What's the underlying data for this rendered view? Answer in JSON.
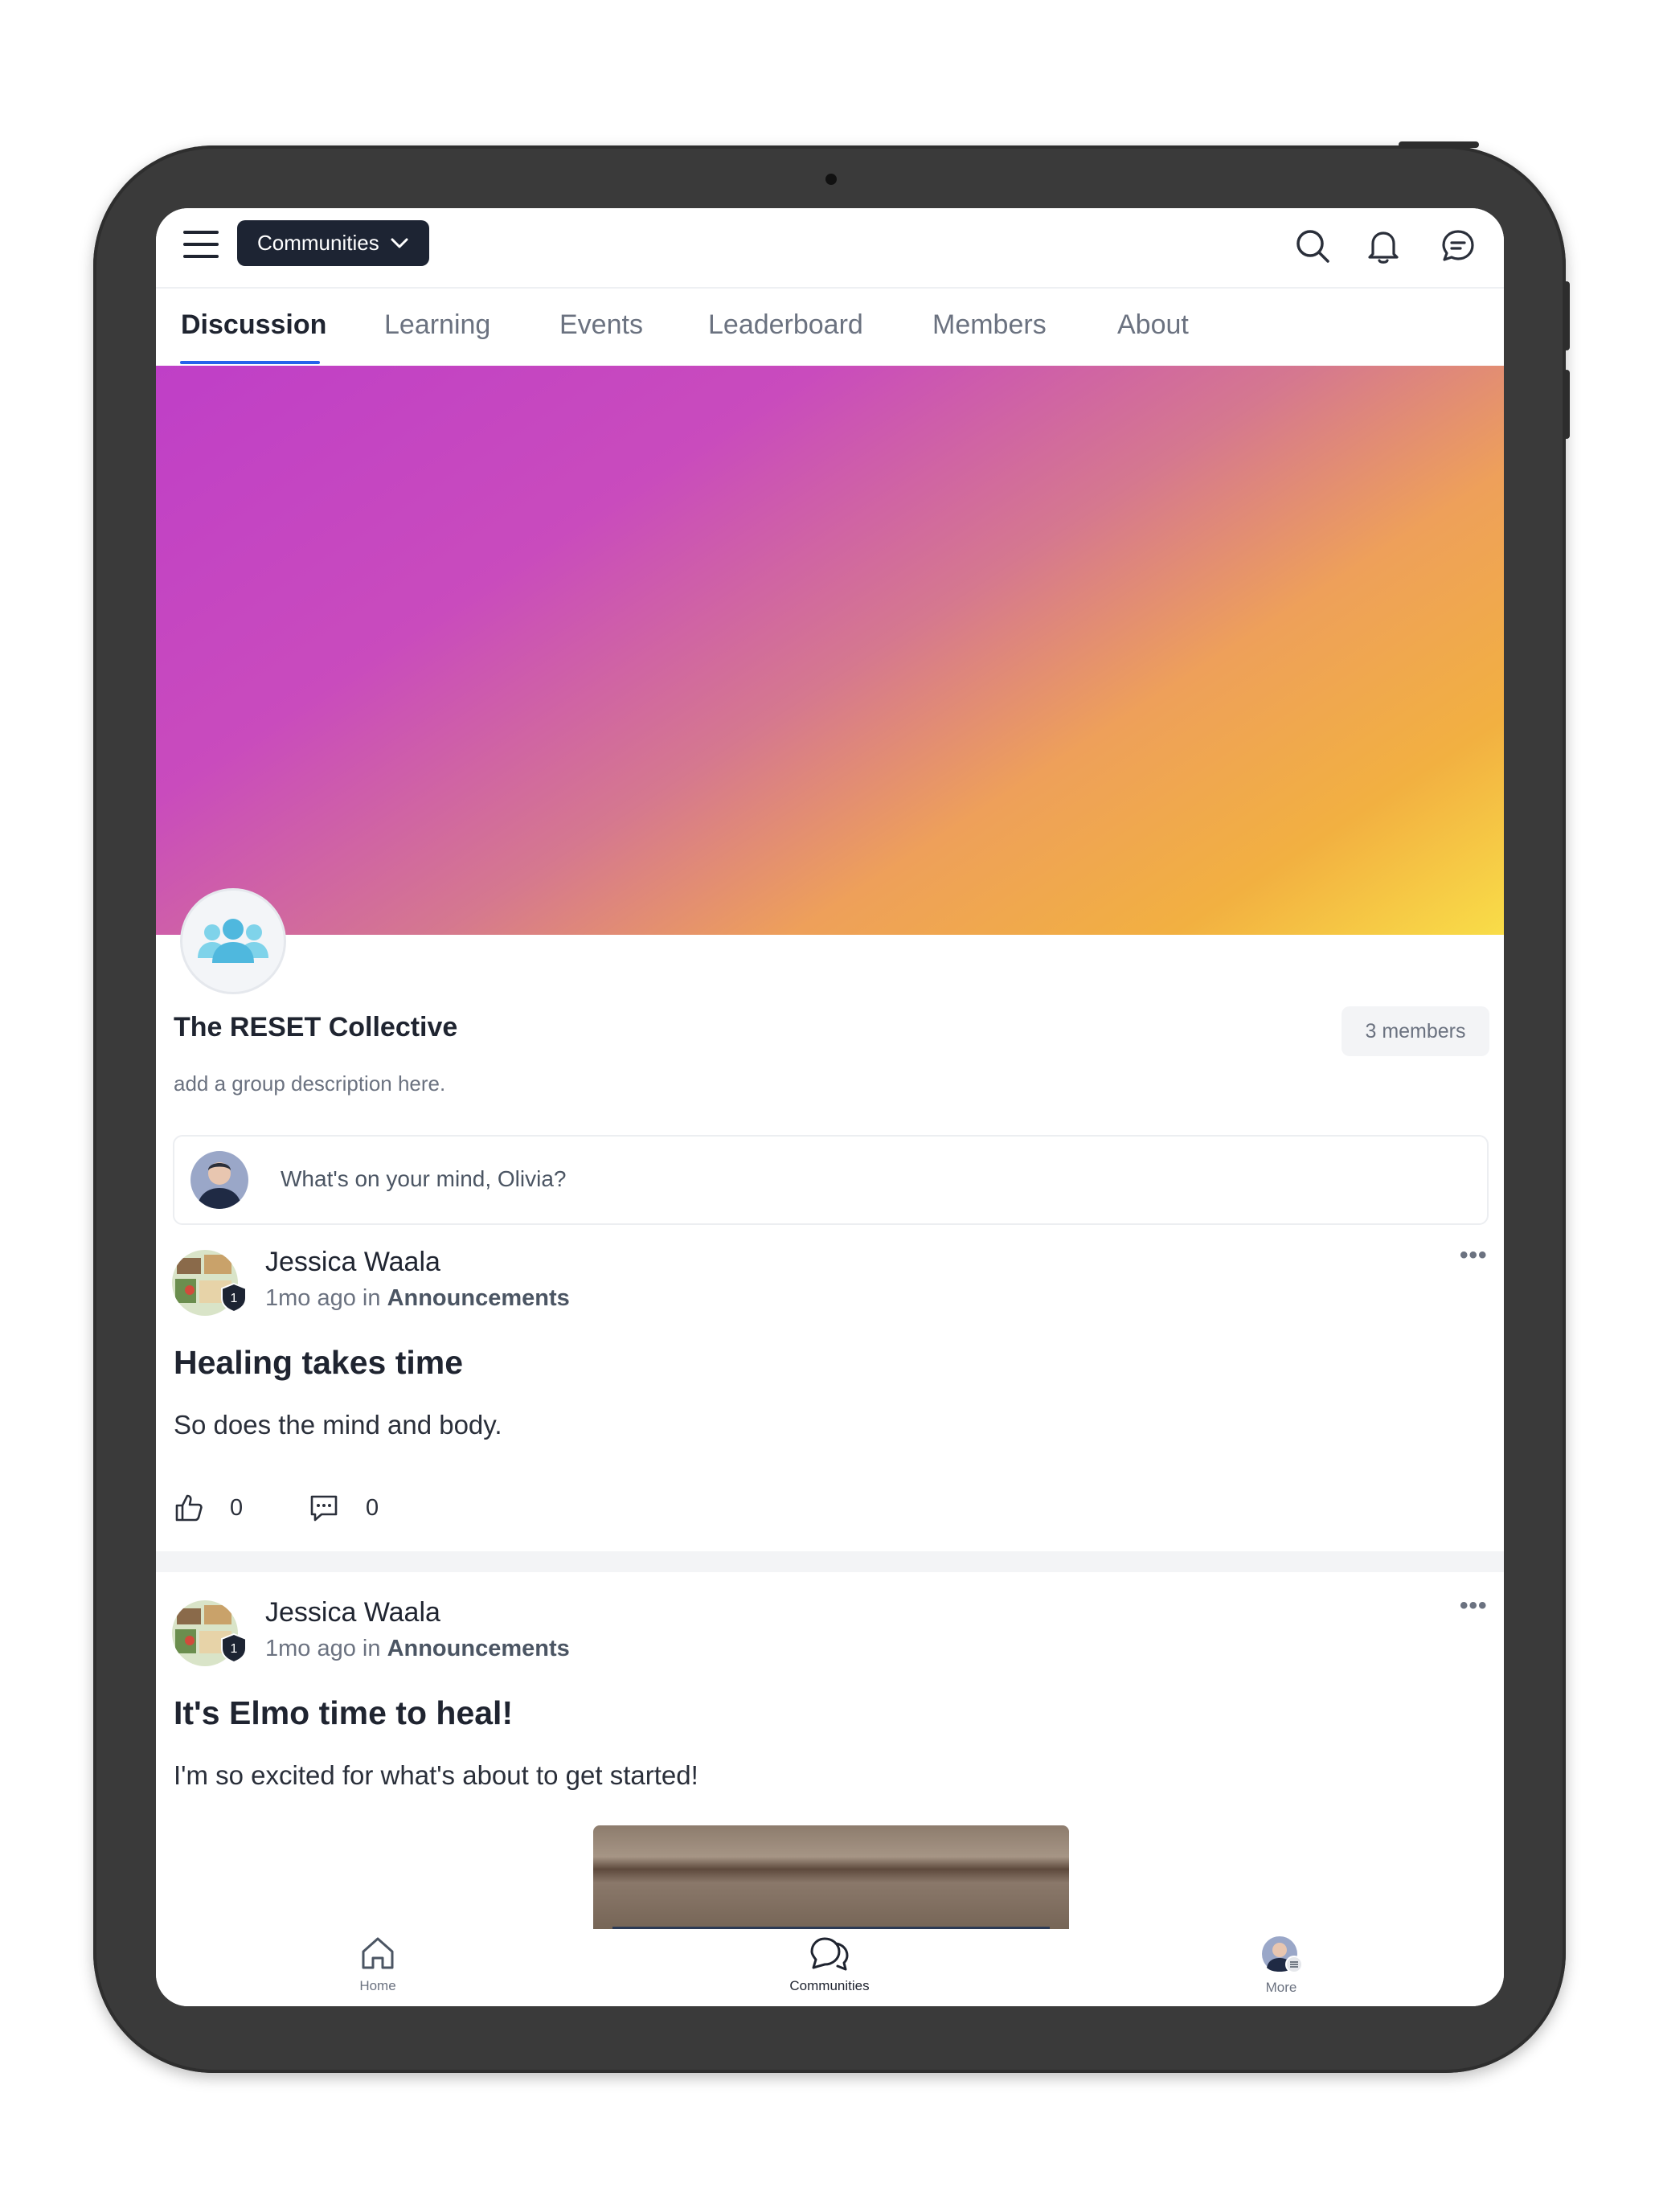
{
  "header": {
    "community_switcher_label": "Communities"
  },
  "tabs": [
    {
      "label": "Discussion",
      "active": true
    },
    {
      "label": "Learning",
      "active": false
    },
    {
      "label": "Events",
      "active": false
    },
    {
      "label": "Leaderboard",
      "active": false
    },
    {
      "label": "Members",
      "active": false
    },
    {
      "label": "About",
      "active": false
    }
  ],
  "group": {
    "name": "The RESET Collective",
    "members_label": "3 members",
    "description": "add a group description here."
  },
  "composer": {
    "placeholder": "What's on your mind, Olivia?"
  },
  "posts": [
    {
      "author": "Jessica Waala",
      "badge_level": "1",
      "time": "1mo ago",
      "in_word": "in",
      "category": "Announcements",
      "more": "•••",
      "title": "Healing takes time",
      "body": "So does the mind and body.",
      "likes": "0",
      "comments": "0"
    },
    {
      "author": "Jessica Waala",
      "badge_level": "1",
      "time": "1mo ago",
      "in_word": "in",
      "category": "Announcements",
      "more": "•••",
      "title": "It's Elmo time to heal!",
      "body": "I'm so excited for what's about to get started!"
    }
  ],
  "bottom_nav": [
    {
      "label": "Home",
      "icon": "home-icon",
      "active": false
    },
    {
      "label": "Communities",
      "icon": "communities-icon",
      "active": true
    },
    {
      "label": "More",
      "icon": "profile-avatar",
      "active": false
    }
  ],
  "colors": {
    "accent": "#2563eb",
    "switcher_bg": "#1d2433",
    "device_frame": "#3a3a3a"
  }
}
